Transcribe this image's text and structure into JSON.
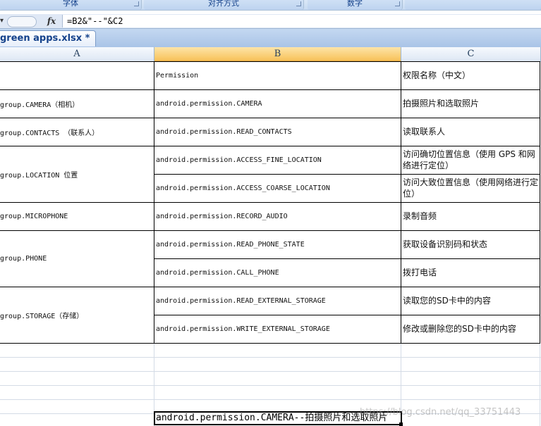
{
  "ribbon": {
    "groups": [
      "字体",
      "对齐方式",
      "数字"
    ]
  },
  "formula_bar": {
    "fx_label": "fx",
    "formula": "=B2&\"--\"&C2"
  },
  "workbook_tab": {
    "label": "green apps.xlsx *"
  },
  "columns": [
    "A",
    "B",
    "C"
  ],
  "selected_column": "B",
  "header_row": {
    "a": "",
    "b": "Permission",
    "c": "权限名称（中文）"
  },
  "groups": [
    {
      "a": "group.CAMERA（相机）",
      "rows": [
        {
          "b": "android.permission.CAMERA",
          "c": "拍摄照片和选取照片"
        }
      ]
    },
    {
      "a": "group.CONTACTS （联系人）",
      "rows": [
        {
          "b": "android.permission.READ_CONTACTS",
          "c": "读取联系人"
        }
      ]
    },
    {
      "a": "group.LOCATION 位置",
      "rows": [
        {
          "b": "android.permission.ACCESS_FINE_LOCATION",
          "c": "访问确切位置信息（使用 GPS 和网络进行定位）"
        },
        {
          "b": "android.permission.ACCESS_COARSE_LOCATION",
          "c": "访问大致位置信息（使用网络进行定位）"
        }
      ]
    },
    {
      "a": "group.MICROPHONE",
      "rows": [
        {
          "b": "android.permission.RECORD_AUDIO",
          "c": "录制音频"
        }
      ]
    },
    {
      "a": "group.PHONE",
      "rows": [
        {
          "b": "android.permission.READ_PHONE_STATE",
          "c": "获取设备识别码和状态"
        },
        {
          "b": "android.permission.CALL_PHONE",
          "c": "拨打电话"
        }
      ]
    },
    {
      "a": "group.STORAGE（存储）",
      "rows": [
        {
          "b": "android.permission.READ_EXTERNAL_STORAGE",
          "c": "读取您的SD卡中的内容"
        },
        {
          "b": "android.permission.WRITE_EXTERNAL_STORAGE",
          "c": "修改或删除您的SD卡中的内容"
        }
      ]
    }
  ],
  "result_cell": {
    "value": "android.permission.CAMERA--拍摄照片和选取照片"
  },
  "watermark": "https://blog.csdn.net/qq_33751443"
}
